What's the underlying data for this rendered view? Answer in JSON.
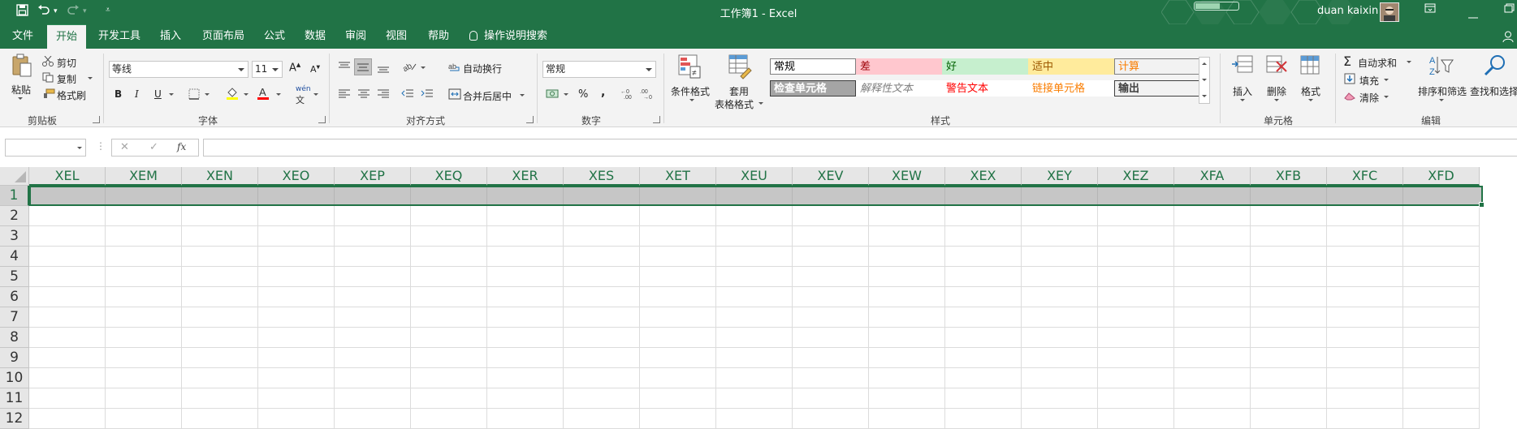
{
  "app": {
    "title": "工作簿1  -  Excel",
    "user": "duan kaixin",
    "accent": "#217346"
  },
  "quick_access": {
    "save_icon": "save-icon",
    "undo_icon": "undo-icon",
    "redo_icon": "redo-icon",
    "customize_icon": "customize-qat-icon"
  },
  "window_controls": {
    "ribbon_options_icon": "ribbon-display-icon",
    "minimize_icon": "minimize-icon",
    "restore_icon": "restore-icon"
  },
  "tabs": [
    "文件",
    "开始",
    "开发工具",
    "插入",
    "页面布局",
    "公式",
    "数据",
    "审阅",
    "视图",
    "帮助"
  ],
  "active_tab": "开始",
  "tell_me": "操作说明搜索",
  "ribbon": {
    "clipboard": {
      "paste": "粘贴",
      "cut": "剪切",
      "copy": "复制",
      "format_painter": "格式刷",
      "label": "剪贴板"
    },
    "font": {
      "name": "等线",
      "size": "11",
      "grow": "A",
      "shrink": "A",
      "bold": "B",
      "italic": "I",
      "underline": "U",
      "wen": "wén",
      "wen_char": "文",
      "label": "字体"
    },
    "alignment": {
      "wrap_text": "自动换行",
      "merge_center": "合并后居中",
      "label": "对齐方式"
    },
    "number": {
      "format": "常规",
      "percent": "%",
      "comma": ",",
      "label": "数字"
    },
    "styles": {
      "conditional_formatting": "条件格式",
      "format_as_table_1": "套用",
      "format_as_table_2": "表格格式",
      "cells": [
        {
          "label": "常规",
          "bg": "#ffffff",
          "fg": "#000000",
          "border": "#7f7f7f"
        },
        {
          "label": "差",
          "bg": "#ffc7ce",
          "fg": "#9c0006",
          "border": "#ffc7ce"
        },
        {
          "label": "好",
          "bg": "#c6efce",
          "fg": "#006100",
          "border": "#c6efce"
        },
        {
          "label": "适中",
          "bg": "#ffeb9c",
          "fg": "#9c5700",
          "border": "#ffeb9c"
        },
        {
          "label": "计算",
          "bg": "#f2f2f2",
          "fg": "#fa7d00",
          "border": "#7f7f7f"
        },
        {
          "label": "检查单元格",
          "bg": "#a5a5a5",
          "fg": "#ffffff",
          "border": "#3f3f3f"
        },
        {
          "label": "解释性文本",
          "bg": "#ffffff",
          "fg": "#7f7f7f",
          "border": "#ffffff"
        },
        {
          "label": "警告文本",
          "bg": "#ffffff",
          "fg": "#ff0000",
          "border": "#ffffff"
        },
        {
          "label": "链接单元格",
          "bg": "#ffffff",
          "fg": "#fa7d00",
          "border": "#ffffff"
        },
        {
          "label": "输出",
          "bg": "#f2f2f2",
          "fg": "#3f3f3f",
          "border": "#3f3f3f"
        }
      ],
      "label": "样式"
    },
    "cells": {
      "insert": "插入",
      "delete": "删除",
      "format": "格式",
      "label": "单元格"
    },
    "editing": {
      "autosum": "自动求和",
      "fill": "填充",
      "clear": "清除",
      "sort_filter": "排序和筛选",
      "find_select": "查找和选择",
      "label": "编辑"
    }
  },
  "formula_bar": {
    "name_box": "",
    "cancel": "✕",
    "enter": "✓",
    "fx": "fx",
    "content": ""
  },
  "grid": {
    "columns": [
      "XEL",
      "XEM",
      "XEN",
      "XEO",
      "XEP",
      "XEQ",
      "XER",
      "XES",
      "XET",
      "XEU",
      "XEV",
      "XEW",
      "XEX",
      "XEY",
      "XEZ",
      "XFA",
      "XFB",
      "XFC",
      "XFD"
    ],
    "rows": [
      "1",
      "2",
      "3",
      "4",
      "5",
      "6",
      "7",
      "8",
      "9",
      "10",
      "11",
      "12"
    ],
    "selected_row": "1"
  }
}
